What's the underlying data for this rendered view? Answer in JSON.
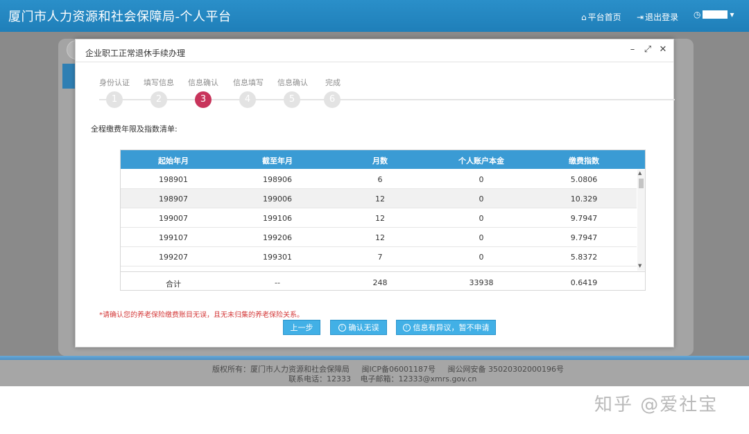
{
  "header": {
    "title": "厦门市人力资源和社会保障局-个人平台",
    "home_link": "平台首页",
    "logout_link": "退出登录",
    "user_caret": "▾"
  },
  "modal": {
    "title": "企业职工正常退休手续办理",
    "steps": [
      {
        "label": "身份认证",
        "number": "1"
      },
      {
        "label": "填写信息",
        "number": "2"
      },
      {
        "label": "信息确认",
        "number": "3"
      },
      {
        "label": "信息填写",
        "number": "4"
      },
      {
        "label": "信息确认",
        "number": "5"
      },
      {
        "label": "完成",
        "number": "6"
      }
    ],
    "active_step": 3,
    "list_title": "全程缴费年限及指数清单:",
    "table": {
      "headers": [
        "起始年月",
        "截至年月",
        "月数",
        "个人账户本金",
        "缴费指数"
      ],
      "rows": [
        [
          "198901",
          "198906",
          "6",
          "0",
          "5.0806"
        ],
        [
          "198907",
          "199006",
          "12",
          "0",
          "10.329"
        ],
        [
          "199007",
          "199106",
          "12",
          "0",
          "9.7947"
        ],
        [
          "199107",
          "199206",
          "12",
          "0",
          "9.7947"
        ],
        [
          "199207",
          "199301",
          "7",
          "0",
          "5.8372"
        ]
      ],
      "summary": [
        "合计",
        "--",
        "248",
        "33938",
        "0.6419"
      ]
    },
    "notice": "*请确认您的养老保险缴费账目无误，且无未归集的养老保险关系。",
    "buttons": {
      "prev": "上一步",
      "confirm": "确认无误",
      "dispute": "信息有异议，暂不申请"
    }
  },
  "footer": {
    "copyright": "版权所有：厦门市人力资源和社会保障局",
    "icp": "闽ICP备06001187号",
    "police": "闽公网安备 35020302000196号",
    "phone": "联系电话：12333",
    "email": "电子邮箱：12333@xmrs.gov.cn"
  },
  "watermark": "知乎 @爱社宝",
  "colors": {
    "header_blue": "#1f7fb9",
    "table_header": "#3a9bd4",
    "active_step": "#c8345b",
    "button_blue": "#42b0e6",
    "notice_red": "#d43a3a"
  }
}
